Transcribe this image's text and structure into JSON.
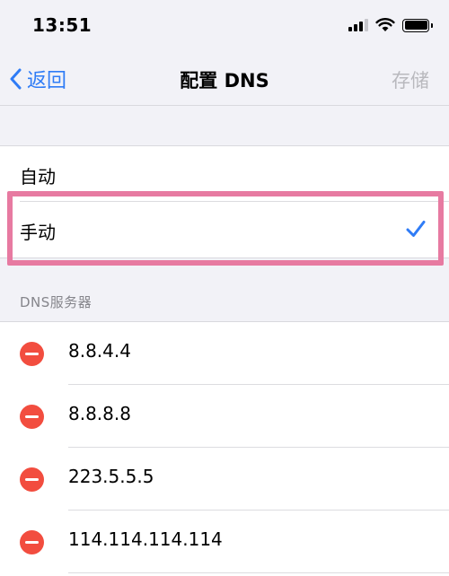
{
  "status_bar": {
    "time": "13:51"
  },
  "nav": {
    "back_label": "返回",
    "title": "配置 DNS",
    "save_label": "存储"
  },
  "modes": [
    {
      "label": "自动",
      "selected": false
    },
    {
      "label": "手动",
      "selected": true
    }
  ],
  "dns_section": {
    "header": "DNS服务器",
    "servers": [
      "8.8.4.4",
      "8.8.8.8",
      "223.5.5.5",
      "114.114.114.114"
    ]
  },
  "colors": {
    "accent": "#2f7cf6",
    "delete": "#f24d3f",
    "highlight": "#e77aa1"
  }
}
